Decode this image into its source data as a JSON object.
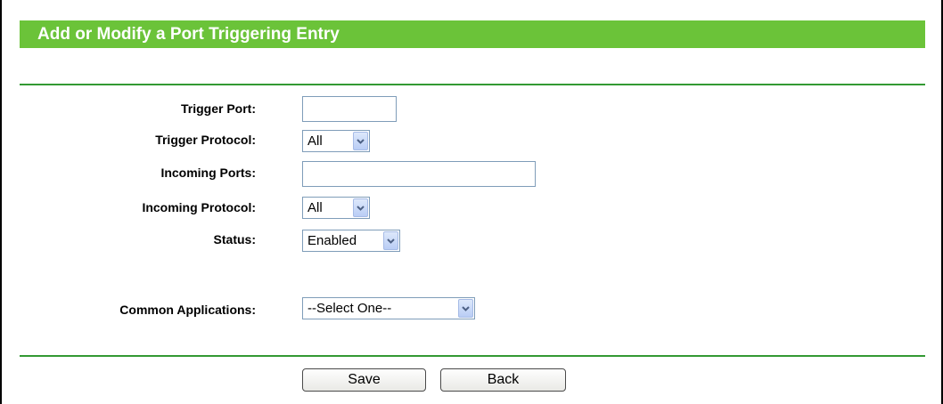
{
  "title": "Add or Modify a Port Triggering Entry",
  "fields": {
    "trigger_port": {
      "label": "Trigger Port:",
      "value": ""
    },
    "trigger_protocol": {
      "label": "Trigger Protocol:",
      "value": "All"
    },
    "incoming_ports": {
      "label": "Incoming Ports:",
      "value": ""
    },
    "incoming_protocol": {
      "label": "Incoming Protocol:",
      "value": "All"
    },
    "status": {
      "label": "Status:",
      "value": "Enabled"
    },
    "common_applications": {
      "label": "Common Applications:",
      "value": "--Select One--"
    }
  },
  "buttons": {
    "save": "Save",
    "back": "Back"
  },
  "colors": {
    "title_bar": "#6bc339",
    "separator": "#339933",
    "dropdown_arrow": "#4d6185"
  },
  "icons": {
    "dropdown": "chevron-down-icon"
  }
}
